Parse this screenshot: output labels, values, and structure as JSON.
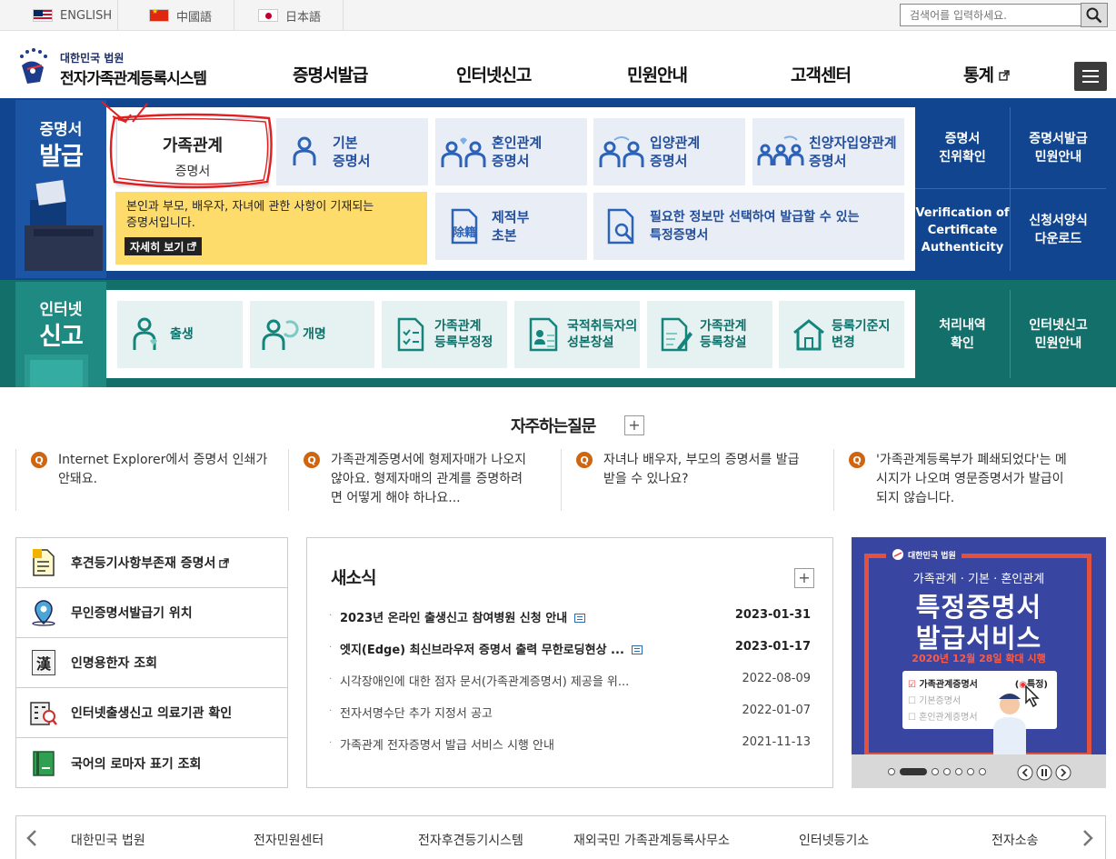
{
  "lang": {
    "english": "ENGLISH",
    "chinese": "中國語",
    "japanese": "日本語"
  },
  "search": {
    "placeholder": "검색어를 입력하세요."
  },
  "logo": {
    "sub": "대한민국 법원",
    "main": "전자가족관계등록시스템"
  },
  "gnb": [
    "증명서발급",
    "인터넷신고",
    "민원안내",
    "고객센터",
    "통계"
  ],
  "issue": {
    "title_small": "증명서",
    "title_big": "발급",
    "cards": [
      {
        "line1": "가족관계",
        "line2": "증명서"
      },
      {
        "label": "기본\n증명서"
      },
      {
        "label": "혼인관계\n증명서"
      },
      {
        "label": "입양관계\n증명서"
      },
      {
        "label": "친양자입양관계\n증명서"
      },
      {
        "label": "제적부\n초본"
      },
      {
        "label": "필요한 정보만 선택하여 발급할 수 있는\n특정증명서"
      }
    ],
    "tooltip": {
      "text": "본인과 부모, 배우자, 자녀에 관한 사항이 기재되는\n증명서입니다.",
      "more": "자세히 보기"
    },
    "jejeok_hanja": "除籍",
    "side": [
      "증명서\n진위확인",
      "증명서발급\n민원안내",
      "Verification of\nCertificate\nAuthenticity",
      "신청서양식\n다운로드"
    ]
  },
  "report": {
    "title_small": "인터넷",
    "title_big": "신고",
    "cards": [
      "출생",
      "개명",
      "가족관계\n등록부정정",
      "국적취득자의\n성본창설",
      "가족관계\n등록창설",
      "등록기준지\n변경"
    ],
    "side": [
      "처리내역\n확인",
      "인터넷신고\n민원안내"
    ]
  },
  "faq": {
    "title": "자주하는질문",
    "plus": "+",
    "q": "Q",
    "items": [
      "Internet Explorer에서 증명서 인쇄가\n안돼요.",
      "가족관계증명서에 형제자매가 나오지\n않아요. 형제자매의 관계를 증명하려\n면 어떻게 해야 하나요...",
      "자녀나 배우자, 부모의 증명서를 발급\n받을 수 있나요?",
      "'가족관계등록부가 폐쇄되었다'는 메\n시지가 나오며 영문증명서가 발급이\n되지 않습니다."
    ]
  },
  "quick": [
    "후견등기사항부존재 증명서",
    "무인증명서발급기 위치",
    "인명용한자 조회",
    "인터넷출생신고 의료기관 확인",
    "국어의 로마자 표기 조회"
  ],
  "quick_hanja": "漢",
  "news": {
    "title": "새소식",
    "plus": "+",
    "bullet": "·",
    "items": [
      {
        "title": "2023년 온라인 출생신고 참여병원 신청 안내",
        "date": "2023-01-31",
        "bold": true
      },
      {
        "title": "엣지(Edge) 최신브라우저 증명서 출력 무한로딩현상 ...",
        "date": "2023-01-17",
        "bold": true
      },
      {
        "title": "시각장애인에 대한 점자 문서(가족관계증명서) 제공을 위...",
        "date": "2022-08-09",
        "bold": false
      },
      {
        "title": "전자서명수단 추가 지정서 공고",
        "date": "2022-01-07",
        "bold": false
      },
      {
        "title": "가족관계 전자증명서 발급 서비스 시행 안내",
        "date": "2021-11-13",
        "bold": false
      }
    ]
  },
  "banner": {
    "org": "대한민국 법원",
    "subtitle": "가족관계 · 기본 · 혼인관계",
    "title1": "특정증명서",
    "title2": "발급서비스",
    "date": "2020년 12월 28일 확대 시행",
    "opts": [
      "가족관계증명서",
      "기본증명서",
      "혼인관계증명서"
    ],
    "opt_tag": "특정"
  },
  "footer": [
    "대한민국 법원",
    "전자민원센터",
    "전자후견등기시스템",
    "재외국민 가족관계등록사무소",
    "인터넷등기소",
    "전자소송"
  ]
}
